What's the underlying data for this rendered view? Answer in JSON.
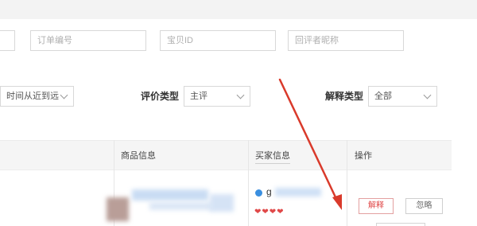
{
  "filters": {
    "order_no_placeholder": "订单编号",
    "item_id_placeholder": "宝贝ID",
    "reviewer_nick_placeholder": "回评者昵称",
    "time_sort_value": "时间从近到远",
    "review_type_label": "评价类型",
    "review_type_value": "主评",
    "explain_type_label": "解释类型",
    "explain_type_value": "全部"
  },
  "table": {
    "headers": [
      "商品信息",
      "买家信息",
      "操作"
    ],
    "row": {
      "buyer_name_visible": "g",
      "actions": [
        "解释",
        "忽略"
      ]
    }
  },
  "colors": {
    "accent_red": "#e04848",
    "arrow_red": "#d93a2b",
    "header_bg": "#f5f5f5"
  },
  "icons": {
    "buyer_avatar": "buyer-avatar-icon",
    "credit_hearts": "heart-icon"
  }
}
